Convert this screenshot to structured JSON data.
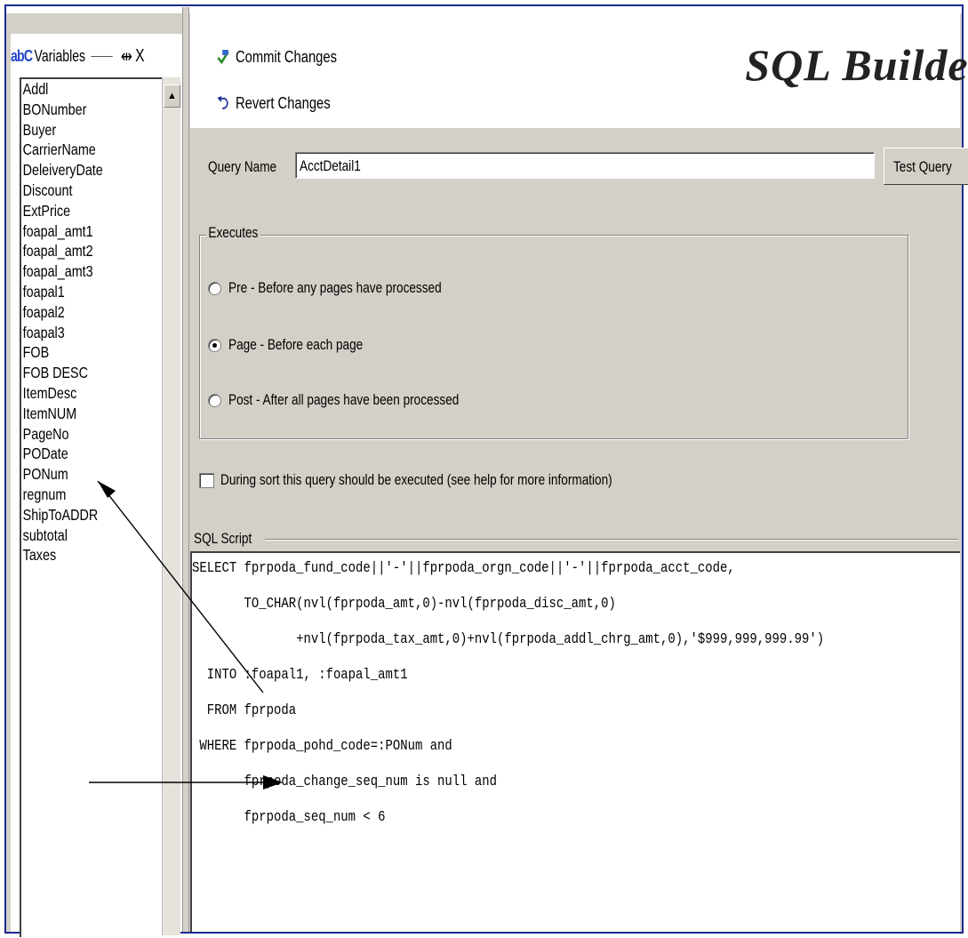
{
  "variables_panel": {
    "title_prefix": "abC",
    "title": "Variables",
    "pin_glyph": "⇹",
    "close_glyph": "X",
    "items": [
      "Addl",
      "BONumber",
      "Buyer",
      "CarrierName",
      "DeleiveryDate",
      "Discount",
      "ExtPrice",
      "foapal_amt1",
      "foapal_amt2",
      "foapal_amt3",
      "foapal1",
      "foapal2",
      "foapal3",
      "FOB",
      "FOB DESC",
      "ItemDesc",
      "ItemNUM",
      "PageNo",
      "PODate",
      "PONum",
      "regnum",
      "ShipToADDR",
      "subtotal",
      "Taxes"
    ]
  },
  "toolbar": {
    "commit_label": "Commit Changes",
    "revert_label": "Revert Changes",
    "banner": "SQL Builder"
  },
  "form": {
    "query_name_label": "Query Name",
    "query_name_value": "AcctDetail1",
    "test_button": "Test Query",
    "executes_legend": "Executes",
    "radios": [
      {
        "label": "Pre - Before any pages have processed",
        "selected": false
      },
      {
        "label": "Page - Before each page",
        "selected": true
      },
      {
        "label": "Post - After all pages have been processed",
        "selected": false
      }
    ],
    "sort_checkbox_label": "During sort this query should be executed (see help for more information)",
    "sort_checkbox_checked": false,
    "sql_script_legend": "SQL Script"
  },
  "sql_script": [
    "SELECT fprpoda_fund_code||'-'||fprpoda_orgn_code||'-'||fprpoda_acct_code,",
    "       TO_CHAR(nvl(fprpoda_amt,0)-nvl(fprpoda_disc_amt,0)",
    "              +nvl(fprpoda_tax_amt,0)+nvl(fprpoda_addl_chrg_amt,0),'$999,999,999.99')",
    "  INTO :foapal1, :foapal_amt1",
    "  FROM fprpoda",
    " WHERE fprpoda_pohd_code=:PONum and",
    "       fprpoda_change_seq_num is null and",
    "       fprpoda_seq_num < 6"
  ],
  "colors": {
    "frame": "#1a2a8c",
    "panel_bg": "#d4d0c8",
    "accent": "#2244cc"
  }
}
